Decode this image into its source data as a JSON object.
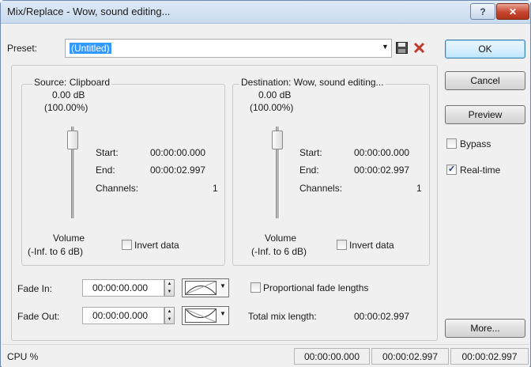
{
  "window": {
    "title": "Mix/Replace - Wow, sound editing...",
    "help_label": "?",
    "close_label": "✕"
  },
  "preset": {
    "label": "Preset:",
    "value": "(Untitled)"
  },
  "buttons": {
    "ok": "OK",
    "cancel": "Cancel",
    "preview": "Preview",
    "more": "More..."
  },
  "options": {
    "bypass": {
      "label": "Bypass",
      "checked": false
    },
    "realtime": {
      "label": "Real-time",
      "checked": true
    }
  },
  "source": {
    "title": "Source: Clipboard",
    "db": "0.00 dB",
    "pct": "(100.00%)",
    "start_label": "Start:",
    "start": "00:00:00.000",
    "end_label": "End:",
    "end": "00:00:02.997",
    "channels_label": "Channels:",
    "channels": "1",
    "volume_label": "Volume",
    "volume_range": "(-Inf. to 6 dB)",
    "invert_label": "Invert data"
  },
  "destination": {
    "title": "Destination: Wow, sound editing...",
    "db": "0.00 dB",
    "pct": "(100.00%)",
    "start_label": "Start:",
    "start": "00:00:00.000",
    "end_label": "End:",
    "end": "00:00:02.997",
    "channels_label": "Channels:",
    "channels": "1",
    "volume_label": "Volume",
    "volume_range": "(-Inf. to 6 dB)",
    "invert_label": "Invert data"
  },
  "fades": {
    "fade_in_label": "Fade In:",
    "fade_in": "00:00:00.000",
    "fade_out_label": "Fade Out:",
    "fade_out": "00:00:00.000",
    "proportional_label": "Proportional fade lengths",
    "total_label": "Total mix length:",
    "total": "00:00:02.997"
  },
  "statusbar": {
    "cpu": "CPU %",
    "t1": "00:00:00.000",
    "t2": "00:00:02.997",
    "t3": "00:00:02.997"
  }
}
